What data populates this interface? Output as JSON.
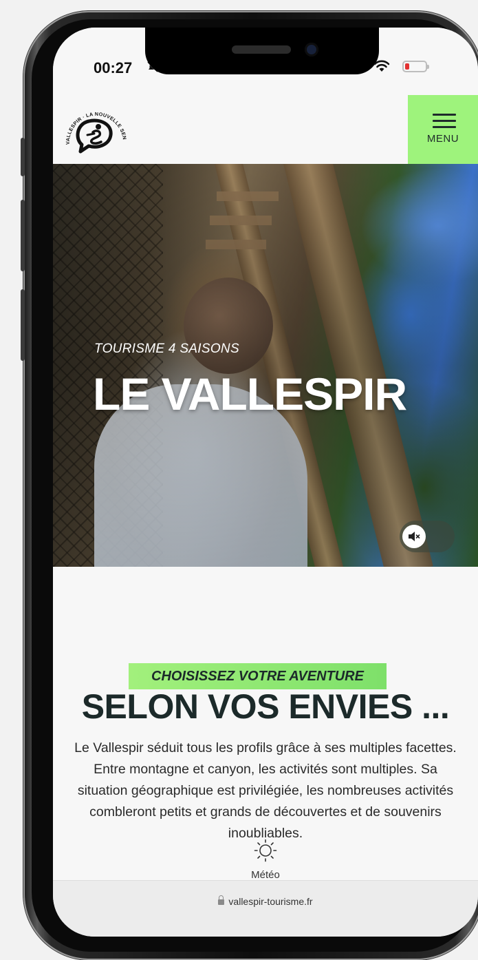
{
  "status_bar": {
    "time": "00:27",
    "icons": [
      "silent-mode-icon",
      "wifi-icon",
      "battery-low-icon"
    ],
    "battery_level": 0.2,
    "battery_color": "#e33333"
  },
  "header": {
    "logo_icon": "vallespir-logo-icon",
    "logo_text_vallespir": "VALLESPIR",
    "logo_text_tagline": "LA NOUVELLE SENSATION CATALANE",
    "menu_label": "MENU",
    "menu_color": "#9ef37c"
  },
  "hero": {
    "kicker": "TOURISME 4 SAISONS",
    "title": "LE VALLESPIR",
    "sound_icon": "mute-icon"
  },
  "section": {
    "tag": "CHOISISSEZ VOTRE AVENTURE",
    "title": "SELON VOS ENVIES ...",
    "text": "Le Vallespir séduit tous les profils grâce à ses multiples facettes. Entre montagne et canyon, les activités sont multiples. Sa situation géographique est privilégiée, les nombreuses activités combleront petits et grands de découvertes et de souvenirs inoubliables.",
    "weather_icon": "sun-icon",
    "weather_label": "Météo"
  },
  "browser": {
    "url": "vallespir-tourisme.fr",
    "lock_icon": "lock-icon"
  }
}
